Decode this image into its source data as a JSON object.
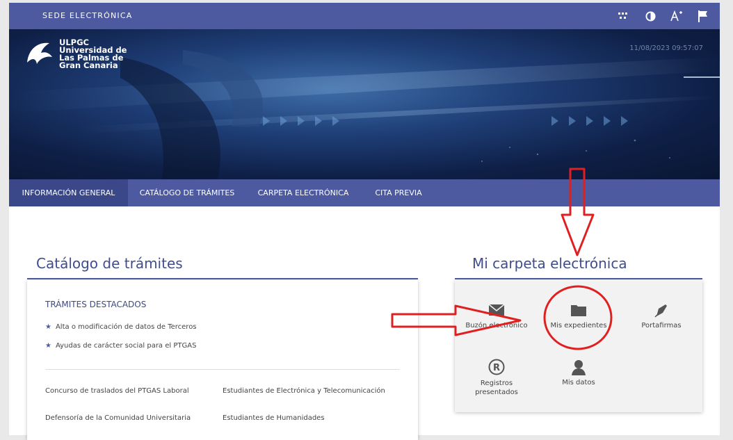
{
  "topbar": {
    "site_title": "SEDE ELECTRÓNICA",
    "tools": [
      "accessibility-grid-icon",
      "contrast-icon",
      "font-size-icon",
      "language-flag-icon"
    ]
  },
  "banner": {
    "logo_lines": [
      "ULPGC",
      "Universidad de",
      "Las Palmas de",
      "Gran Canaria"
    ],
    "datetime": "11/08/2023 09:57:07"
  },
  "nav": {
    "items": [
      {
        "label": "INFORMACIÓN GENERAL",
        "active": true
      },
      {
        "label": "CATÁLOGO DE TRÁMITES",
        "active": false
      },
      {
        "label": "CARPETA ELECTRÓNICA",
        "active": false
      },
      {
        "label": "CITA PREVIA",
        "active": false
      }
    ]
  },
  "catalog": {
    "title": "Catálogo de trámites",
    "featured_title": "TRÁMITES DESTACADOS",
    "featured": [
      "Alta o modificación de datos de Terceros",
      "Ayudas de carácter social para el PTGAS"
    ],
    "links": [
      "Concurso de traslados del PTGAS Laboral",
      "Estudiantes de Electrónica y Telecomunicación",
      "Defensoría de la Comunidad Universitaria",
      "Estudiantes de Humanidades"
    ]
  },
  "folder": {
    "title": "Mi carpeta electrónica",
    "tiles": [
      {
        "label": "Buzón electrónico",
        "icon": "envelope-icon"
      },
      {
        "label": "Mis expedientes",
        "icon": "folder-icon"
      },
      {
        "label": "Portafirmas",
        "icon": "pen-nib-icon"
      },
      {
        "label": "Registros presentados",
        "icon": "registered-icon"
      },
      {
        "label": "Mis datos",
        "icon": "user-icon"
      }
    ]
  },
  "colors": {
    "brand": "#4d5aa0",
    "annotation": "#e02020"
  }
}
